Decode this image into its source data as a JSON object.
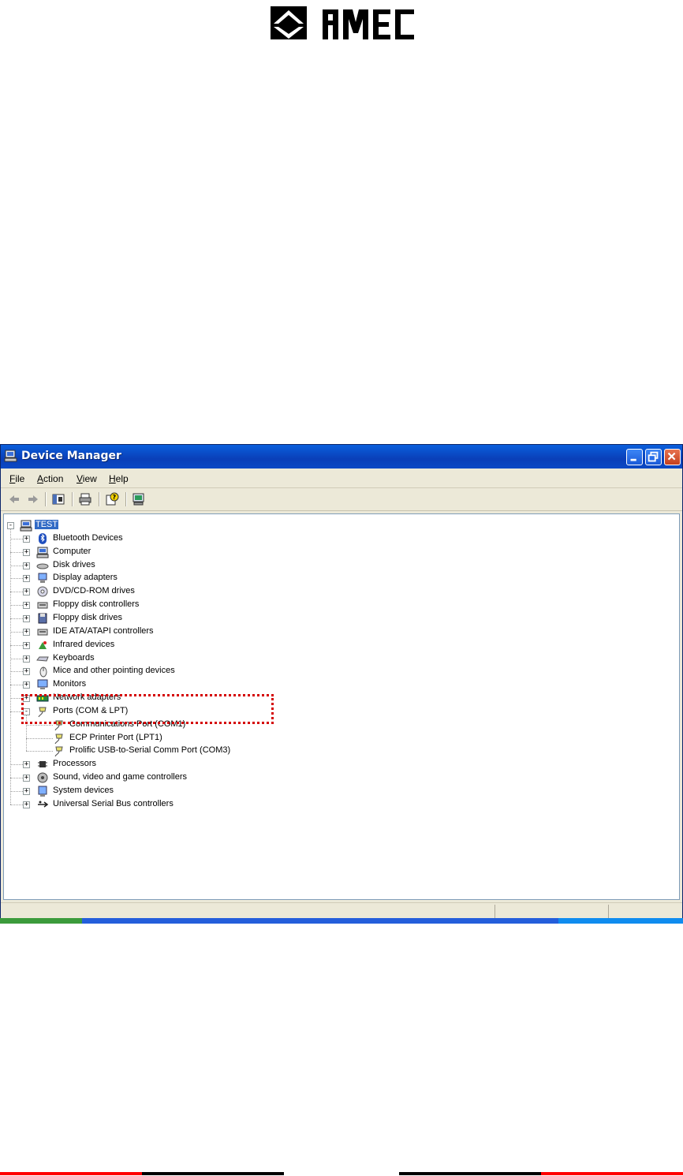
{
  "logo": {
    "brand_text": "AMEC"
  },
  "window": {
    "title": "Device Manager",
    "title_icon": "device-manager-icon",
    "buttons": {
      "minimize": "minimize",
      "maximize": "restore",
      "close": "close"
    },
    "colors": {
      "titlebar": "#0a50d0",
      "selection": "#316ac5",
      "highlight_box": "#d40000"
    }
  },
  "menu": [
    "File",
    "Action",
    "View",
    "Help"
  ],
  "toolbar": {
    "icons": [
      "back-arrow-icon",
      "forward-arrow-icon",
      "show-hide-console-tree-icon",
      "print-icon",
      "properties-help-icon",
      "scan-hardware-icon"
    ]
  },
  "tree": {
    "root": {
      "label": "TEST",
      "expanded": true,
      "selected": true,
      "icon": "computer-icon"
    },
    "categories": [
      {
        "label": "Bluetooth Devices",
        "icon": "bluetooth-icon"
      },
      {
        "label": "Computer",
        "icon": "computer-icon"
      },
      {
        "label": "Disk drives",
        "icon": "disk-drive-icon"
      },
      {
        "label": "Display adapters",
        "icon": "display-adapter-icon"
      },
      {
        "label": "DVD/CD-ROM drives",
        "icon": "cdrom-icon"
      },
      {
        "label": "Floppy disk controllers",
        "icon": "controller-icon"
      },
      {
        "label": "Floppy disk drives",
        "icon": "floppy-icon"
      },
      {
        "label": "IDE ATA/ATAPI controllers",
        "icon": "controller-icon"
      },
      {
        "label": "Infrared devices",
        "icon": "infrared-icon"
      },
      {
        "label": "Keyboards",
        "icon": "keyboard-icon"
      },
      {
        "label": "Mice and other pointing devices",
        "icon": "mouse-icon"
      },
      {
        "label": "Monitors",
        "icon": "monitor-icon"
      },
      {
        "label": "Network adapters",
        "icon": "network-adapter-icon"
      },
      {
        "label": "Ports (COM & LPT)",
        "icon": "port-icon",
        "expanded": true,
        "children": [
          {
            "label": "Communications Port (COM1)",
            "icon": "port-icon"
          },
          {
            "label": "ECP Printer Port (LPT1)",
            "icon": "port-icon"
          },
          {
            "label": "Prolific USB-to-Serial Comm Port (COM3)",
            "icon": "port-icon"
          }
        ]
      },
      {
        "label": "Processors",
        "icon": "processor-icon"
      },
      {
        "label": "Sound, video and game controllers",
        "icon": "sound-icon"
      },
      {
        "label": "System devices",
        "icon": "system-device-icon"
      },
      {
        "label": "Universal Serial Bus controllers",
        "icon": "usb-icon"
      }
    ]
  },
  "footer": {
    "colors": [
      "#ff0000",
      "#000000"
    ]
  }
}
